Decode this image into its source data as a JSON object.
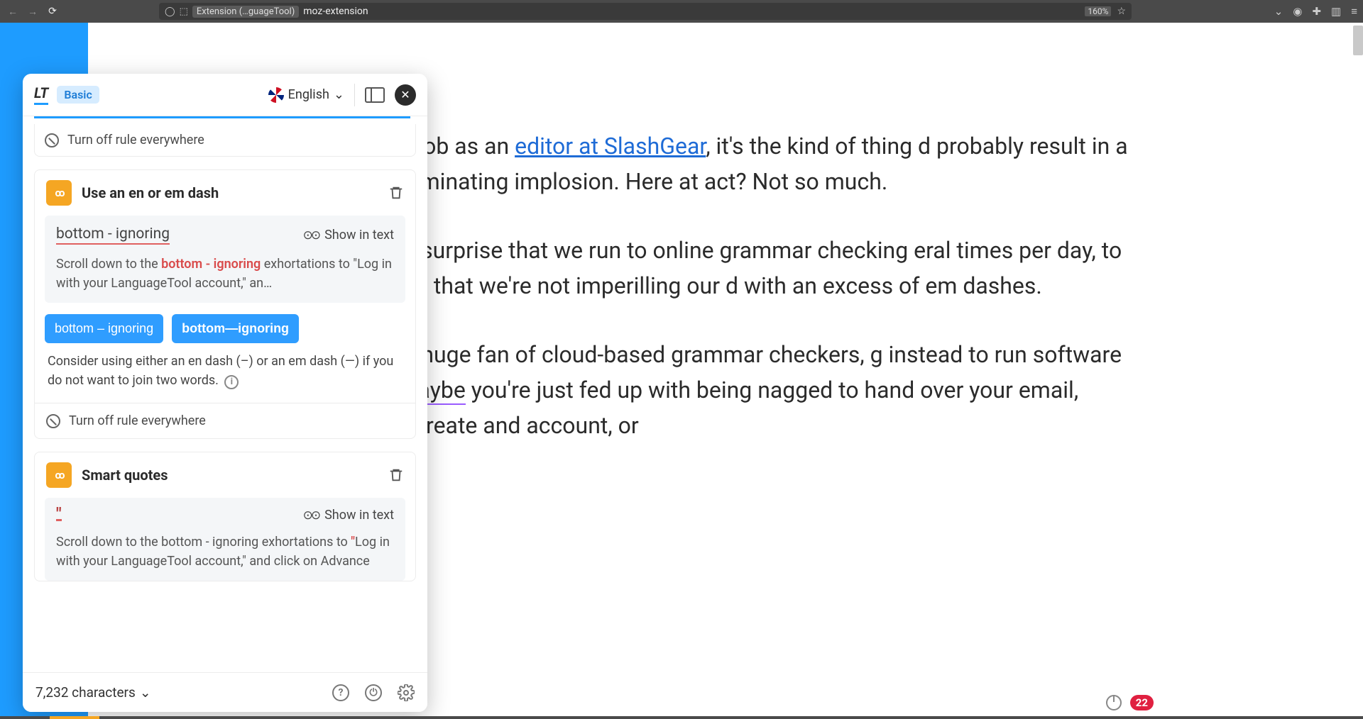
{
  "browser": {
    "extension_chip": "Extension (…guageTool)",
    "url_text": "moz-extension",
    "zoom": "160%"
  },
  "article": {
    "p1_prefix": "iter's day job as an ",
    "p1_link": "editor at SlashGear",
    "p1_suffix": ", it's the kind of thing d probably result in a career-terminating implosion. Here at act? Not so much.",
    "p2": "uld be no surprise that we run to online grammar checking eral times per day, to make sure that we're not imperilling our d with an excess of em dashes.",
    "p3_prefix": "u're not a huge fan of cloud-based grammar checkers, g instead to run software locally. ",
    "p3_underlined": "Maybe",
    "p3_suffix": " you're just fed up with being nagged to hand over your email, address, create and account, or"
  },
  "lt": {
    "plan": "Basic",
    "language": "English",
    "turn_off_label": "Turn off rule everywhere",
    "footer": {
      "char_count": "7,232 characters"
    },
    "cards": {
      "dash": {
        "title": "Use an en or em dash",
        "error_text": "bottom - ignoring",
        "show_in_text": "Show in text",
        "context_prefix": "Scroll down to the ",
        "context_highlight": "bottom - ignoring",
        "context_suffix": " exhortations to \"Log in with your LanguageTool account,\" an…",
        "suggestions": [
          "bottom – ignoring",
          "bottom—ignoring"
        ],
        "description": "Consider using either an en dash (–) or an em dash (—) if you do not want to join two words."
      },
      "quotes": {
        "title": "Smart quotes",
        "error_text": "\"",
        "show_in_text": "Show in text",
        "context_prefix": "Scroll down to the bottom - ignoring exhortations to ",
        "context_highlight": "\"",
        "context_suffix": "Log in with your LanguageTool account,\" and click on Advance"
      }
    }
  },
  "floating": {
    "issue_count": "22"
  }
}
